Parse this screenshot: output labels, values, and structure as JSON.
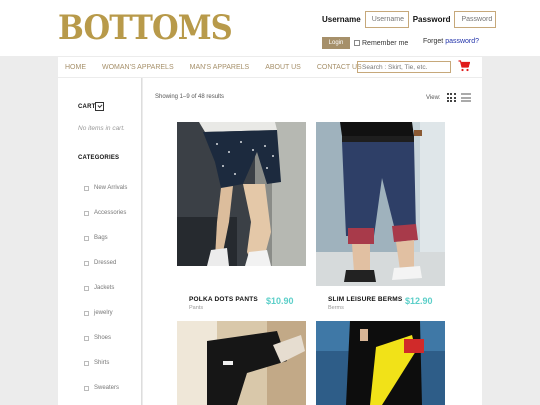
{
  "brand": {
    "logo": "BOTTOMS"
  },
  "login": {
    "username_label": "Username",
    "username_placeholder": "Username",
    "password_label": "Password",
    "password_placeholder": "Password",
    "login_button": "Login",
    "remember_me": "Remember me",
    "forget_prefix": "Forget ",
    "forget_link": "password?"
  },
  "nav": {
    "items": [
      "HOME",
      "WOMAN'S APPARELS",
      "MAN'S APPARELS",
      "ABOUT US",
      "CONTACT US"
    ],
    "search_placeholder": "Search :   Skirt, Tie, etc."
  },
  "sidebar": {
    "cart_title": "CART",
    "cart_empty": "No items in cart.",
    "categories_title": "CATEGORIES",
    "categories": [
      "New Arrivals",
      "Accessories",
      "Bags",
      "Dressed",
      "Jackets",
      "jewelry",
      "Shoes",
      "Shirts",
      "Sweaters"
    ]
  },
  "listing": {
    "results_text": "Showing 1–9 of 48 results",
    "view_label": "View:"
  },
  "products": [
    {
      "name": "POLKA DOTS PANTS",
      "category": "Pants",
      "price": "$10.90"
    },
    {
      "name": "SLIM LEISURE BERMS",
      "category": "Berms",
      "price": "$12.90"
    }
  ],
  "colors": {
    "brand_gold": "#b89a4a",
    "price_teal": "#5ccfc9",
    "cart_red": "#e01b1b"
  }
}
